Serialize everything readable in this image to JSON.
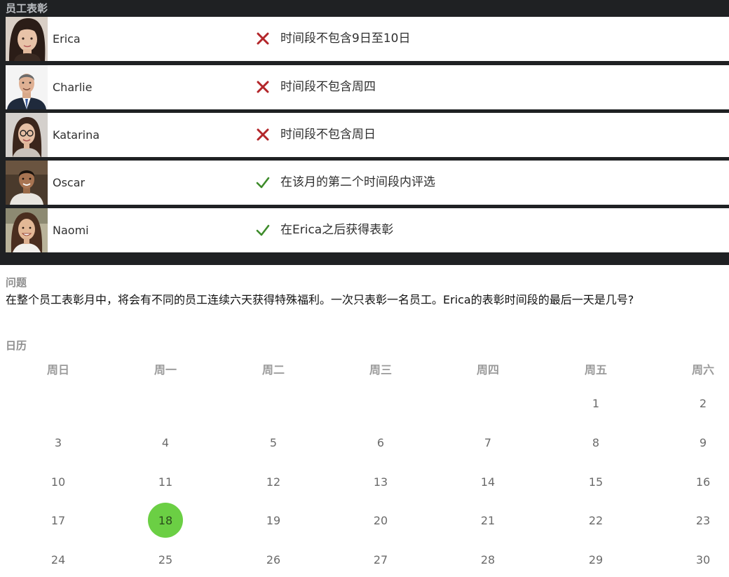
{
  "panel": {
    "title": "员工表彰"
  },
  "employees": [
    {
      "name": "Erica",
      "status": "wrong",
      "clue": "时间段不包含9日至10日",
      "avatar": "woman-dark-hair-avatar"
    },
    {
      "name": "Charlie",
      "status": "wrong",
      "clue": "时间段不包含周四",
      "avatar": "man-suit-avatar"
    },
    {
      "name": "Katarina",
      "status": "wrong",
      "clue": "时间段不包含周日",
      "avatar": "woman-glasses-avatar"
    },
    {
      "name": "Oscar",
      "status": "correct",
      "clue": "在该月的第二个时间段内评选",
      "avatar": "man-dark-hair-avatar"
    },
    {
      "name": "Naomi",
      "status": "correct",
      "clue": "在Erica之后获得表彰",
      "avatar": "woman-smiling-avatar"
    }
  ],
  "colors": {
    "wrong": "#b3262a",
    "correct": "#3d8b2a",
    "selected_day": "#6bcf44",
    "panel_bg": "#1f2123"
  },
  "question": {
    "label": "问题",
    "text": "在整个员工表彰月中，将会有不同的员工连续六天获得特殊福利。一次只表彰一名员工。Erica的表彰时间段的最后一天是几号?"
  },
  "calendar": {
    "label": "日历",
    "weekdays": [
      "周日",
      "周一",
      "周二",
      "周三",
      "周四",
      "周五",
      "周六"
    ],
    "weeks": [
      [
        "",
        "",
        "",
        "",
        "",
        "1",
        "2"
      ],
      [
        "3",
        "4",
        "5",
        "6",
        "7",
        "8",
        "9"
      ],
      [
        "10",
        "11",
        "12",
        "13",
        "14",
        "15",
        "16"
      ],
      [
        "17",
        "18",
        "19",
        "20",
        "21",
        "22",
        "23"
      ],
      [
        "24",
        "25",
        "26",
        "27",
        "28",
        "29",
        "30"
      ]
    ],
    "selected": "18"
  }
}
